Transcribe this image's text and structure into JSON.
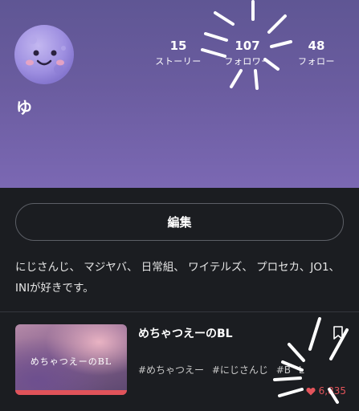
{
  "profile": {
    "username": "ゆ"
  },
  "stats": [
    {
      "value": "15",
      "label": "ストーリー"
    },
    {
      "value": "107",
      "label": "フォロワー"
    },
    {
      "value": "48",
      "label": "フォロー"
    }
  ],
  "actions": {
    "edit_label": "編集"
  },
  "bio": {
    "text": "にじさんじ、 マジヤバ、 日常組、 ワイテルズ、 プロセカ、JO1、 INIが好きです。"
  },
  "story": {
    "title": "めちゃつえーのBL",
    "thumbnail_text": "めちゃつえーのBL",
    "tags": "#めちゃつえー #にじさんじ #B L",
    "likes": "6,835"
  },
  "colors": {
    "header_top": "#5f5694",
    "header_bottom": "#7b68b3",
    "background": "#1b1d21",
    "like_red": "#e3545b"
  },
  "icons": {
    "avatar": "moon-face-icon",
    "bookmark": "bookmark-icon",
    "heart": "heart-icon"
  }
}
